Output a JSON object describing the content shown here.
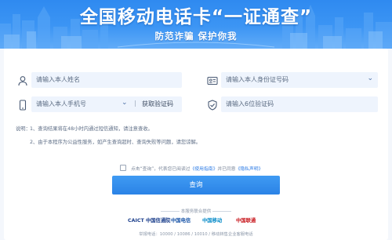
{
  "banner": {
    "title": "全国移动电话卡“一证通查”",
    "subtitle": "防范诈骗 保护你我"
  },
  "form": {
    "name_placeholder": "请输入本人姓名",
    "id_placeholder": "请输入本人身份证号码",
    "phone_placeholder": "请输入本人手机号",
    "send_code_label": "获取验证码",
    "code_placeholder": "请输入6位验证码"
  },
  "notes": {
    "label": "说明：",
    "items": [
      "1、查询结果将在48小时内通过短信通知，请注意查收。",
      "2、由于本程序为公益性服务，如产生查询超时、查询失败等问题，请您谅解。"
    ]
  },
  "agreement": {
    "prefix": "点击“查询”，代表您已阅读过",
    "link1": "《使用指南》",
    "middle": "并已同意",
    "link2": "《隐私声明》"
  },
  "submit_label": "查询",
  "support_text": "本服务联合提供",
  "logos": [
    {
      "name": "CAICT 中国信通院",
      "color": "#1c3f8c",
      "icon": "caict-logo"
    },
    {
      "name": "中国电信",
      "color": "#1a55a8",
      "icon": "china-telecom-logo"
    },
    {
      "name": "中国移动",
      "color": "#0a8cc9",
      "icon": "china-mobile-logo"
    },
    {
      "name": "中国联通",
      "color": "#c8171d",
      "icon": "china-unicom-logo"
    }
  ],
  "footer": "举报电话：10000 / 10086 / 10010 / 移动转售企业客服电话",
  "colors": {
    "accent": "#2b83e6",
    "banner": "#3c95f4",
    "field_bg": "#eef4fd"
  }
}
